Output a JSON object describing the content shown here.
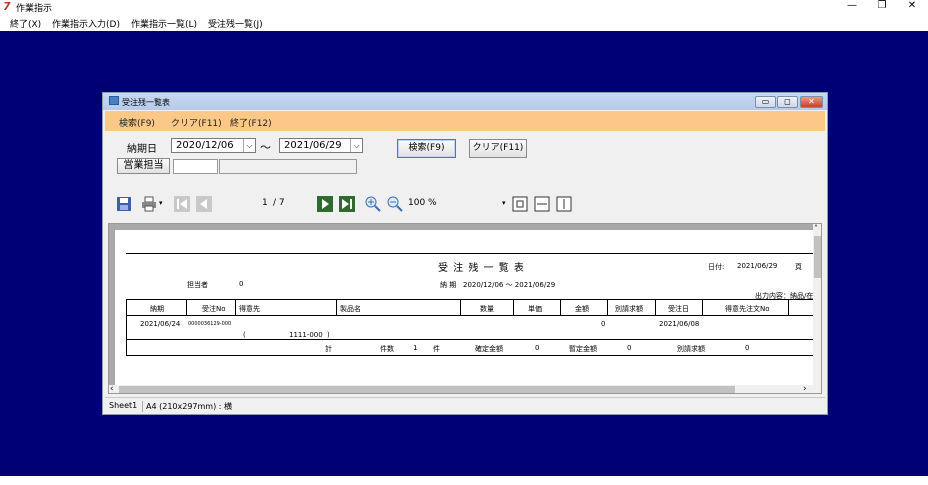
{
  "app": {
    "title": "作業指示",
    "menu": [
      "終了(X)",
      "作業指示入力(D)",
      "作業指示一覧(L)",
      "受注残一覧(J)"
    ]
  },
  "child": {
    "title": "受注残一覧表",
    "menu": [
      "検索(F9)",
      "クリア(F11)",
      "終了(F12)"
    ]
  },
  "form": {
    "date_label": "納期日",
    "date_from": "2020/12/06",
    "range_sep": "〜",
    "date_to": "2021/06/29",
    "sales_label": "営業担当",
    "search_btn": "検索(F9)",
    "clear_btn": "クリア(F11)"
  },
  "toolbar": {
    "page_current": "1",
    "page_total": "/ 7",
    "zoom": "100 %"
  },
  "report": {
    "title": "受 注 残 一 覧 表",
    "date_label": "日付:",
    "date_value": "2021/06/29",
    "page_label": "頁",
    "tantou_label": "担当者",
    "tantou_value": "0",
    "period_label": "納 期",
    "period_value": "2020/12/06 ～ 2021/06/29",
    "output_label": "出力内容：納品/在",
    "headers": [
      "納期",
      "受注No",
      "得意先",
      "製品名",
      "数量",
      "単価",
      "金額",
      "別請求額",
      "受注日",
      "得意先注文No"
    ],
    "row": {
      "nouki": "2021/06/24",
      "juchu_no": "0000036129-000",
      "customer_paren_open": "(",
      "customer_code": "1111-000",
      "customer_paren_close": ")",
      "kingaku": "0",
      "juchu_date": "2021/06/08"
    },
    "footer": {
      "total_label": "計",
      "count_label": "件数",
      "count_value": "1",
      "count_unit": "件",
      "kakutei_label": "確定金額",
      "kakutei_value": "0",
      "zantei_label": "暫定金額",
      "zantei_value": "0",
      "bettsu_label": "別請求額",
      "bettsu_value": "0"
    }
  },
  "status": {
    "sheet": "Sheet1",
    "paper": "A4 (210x297mm) : 横"
  }
}
